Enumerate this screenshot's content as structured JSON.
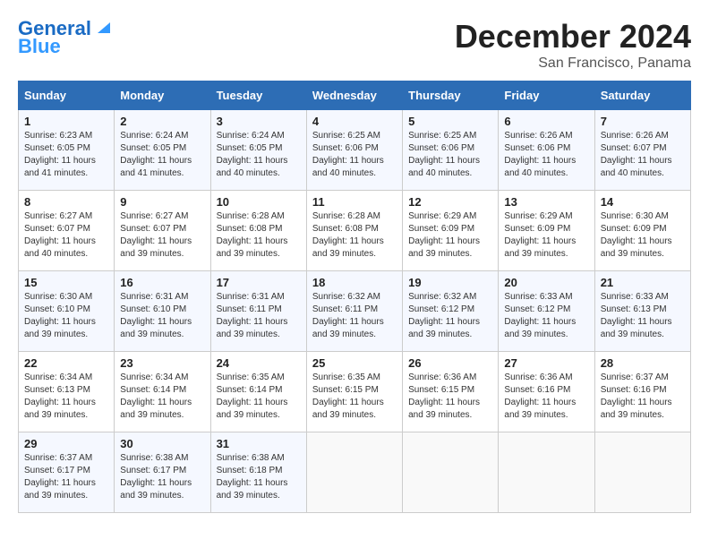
{
  "logo": {
    "line1": "General",
    "line2": "Blue"
  },
  "title": "December 2024",
  "location": "San Francisco, Panama",
  "headers": [
    "Sunday",
    "Monday",
    "Tuesday",
    "Wednesday",
    "Thursday",
    "Friday",
    "Saturday"
  ],
  "weeks": [
    [
      {
        "day": 1,
        "sunrise": "6:23 AM",
        "sunset": "6:05 PM",
        "daylight": "11 hours and 41 minutes."
      },
      {
        "day": 2,
        "sunrise": "6:24 AM",
        "sunset": "6:05 PM",
        "daylight": "11 hours and 41 minutes."
      },
      {
        "day": 3,
        "sunrise": "6:24 AM",
        "sunset": "6:05 PM",
        "daylight": "11 hours and 40 minutes."
      },
      {
        "day": 4,
        "sunrise": "6:25 AM",
        "sunset": "6:06 PM",
        "daylight": "11 hours and 40 minutes."
      },
      {
        "day": 5,
        "sunrise": "6:25 AM",
        "sunset": "6:06 PM",
        "daylight": "11 hours and 40 minutes."
      },
      {
        "day": 6,
        "sunrise": "6:26 AM",
        "sunset": "6:06 PM",
        "daylight": "11 hours and 40 minutes."
      },
      {
        "day": 7,
        "sunrise": "6:26 AM",
        "sunset": "6:07 PM",
        "daylight": "11 hours and 40 minutes."
      }
    ],
    [
      {
        "day": 8,
        "sunrise": "6:27 AM",
        "sunset": "6:07 PM",
        "daylight": "11 hours and 40 minutes."
      },
      {
        "day": 9,
        "sunrise": "6:27 AM",
        "sunset": "6:07 PM",
        "daylight": "11 hours and 39 minutes."
      },
      {
        "day": 10,
        "sunrise": "6:28 AM",
        "sunset": "6:08 PM",
        "daylight": "11 hours and 39 minutes."
      },
      {
        "day": 11,
        "sunrise": "6:28 AM",
        "sunset": "6:08 PM",
        "daylight": "11 hours and 39 minutes."
      },
      {
        "day": 12,
        "sunrise": "6:29 AM",
        "sunset": "6:09 PM",
        "daylight": "11 hours and 39 minutes."
      },
      {
        "day": 13,
        "sunrise": "6:29 AM",
        "sunset": "6:09 PM",
        "daylight": "11 hours and 39 minutes."
      },
      {
        "day": 14,
        "sunrise": "6:30 AM",
        "sunset": "6:09 PM",
        "daylight": "11 hours and 39 minutes."
      }
    ],
    [
      {
        "day": 15,
        "sunrise": "6:30 AM",
        "sunset": "6:10 PM",
        "daylight": "11 hours and 39 minutes."
      },
      {
        "day": 16,
        "sunrise": "6:31 AM",
        "sunset": "6:10 PM",
        "daylight": "11 hours and 39 minutes."
      },
      {
        "day": 17,
        "sunrise": "6:31 AM",
        "sunset": "6:11 PM",
        "daylight": "11 hours and 39 minutes."
      },
      {
        "day": 18,
        "sunrise": "6:32 AM",
        "sunset": "6:11 PM",
        "daylight": "11 hours and 39 minutes."
      },
      {
        "day": 19,
        "sunrise": "6:32 AM",
        "sunset": "6:12 PM",
        "daylight": "11 hours and 39 minutes."
      },
      {
        "day": 20,
        "sunrise": "6:33 AM",
        "sunset": "6:12 PM",
        "daylight": "11 hours and 39 minutes."
      },
      {
        "day": 21,
        "sunrise": "6:33 AM",
        "sunset": "6:13 PM",
        "daylight": "11 hours and 39 minutes."
      }
    ],
    [
      {
        "day": 22,
        "sunrise": "6:34 AM",
        "sunset": "6:13 PM",
        "daylight": "11 hours and 39 minutes."
      },
      {
        "day": 23,
        "sunrise": "6:34 AM",
        "sunset": "6:14 PM",
        "daylight": "11 hours and 39 minutes."
      },
      {
        "day": 24,
        "sunrise": "6:35 AM",
        "sunset": "6:14 PM",
        "daylight": "11 hours and 39 minutes."
      },
      {
        "day": 25,
        "sunrise": "6:35 AM",
        "sunset": "6:15 PM",
        "daylight": "11 hours and 39 minutes."
      },
      {
        "day": 26,
        "sunrise": "6:36 AM",
        "sunset": "6:15 PM",
        "daylight": "11 hours and 39 minutes."
      },
      {
        "day": 27,
        "sunrise": "6:36 AM",
        "sunset": "6:16 PM",
        "daylight": "11 hours and 39 minutes."
      },
      {
        "day": 28,
        "sunrise": "6:37 AM",
        "sunset": "6:16 PM",
        "daylight": "11 hours and 39 minutes."
      }
    ],
    [
      {
        "day": 29,
        "sunrise": "6:37 AM",
        "sunset": "6:17 PM",
        "daylight": "11 hours and 39 minutes."
      },
      {
        "day": 30,
        "sunrise": "6:38 AM",
        "sunset": "6:17 PM",
        "daylight": "11 hours and 39 minutes."
      },
      {
        "day": 31,
        "sunrise": "6:38 AM",
        "sunset": "6:18 PM",
        "daylight": "11 hours and 39 minutes."
      },
      null,
      null,
      null,
      null
    ]
  ]
}
